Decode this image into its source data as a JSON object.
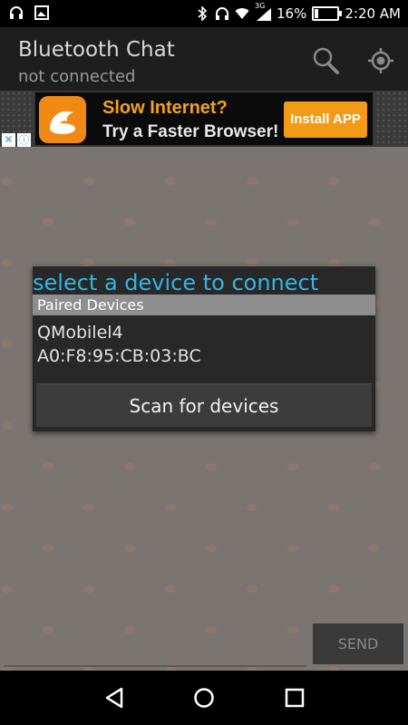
{
  "statusbar": {
    "battery_percent": "16%",
    "time": "2:20 AM",
    "network_type": "3G",
    "icons": [
      "headset-icon",
      "image-icon",
      "bluetooth-icon",
      "headphones-icon",
      "wifi-icon",
      "signal-icon",
      "battery-icon"
    ]
  },
  "actionbar": {
    "title": "Bluetooth Chat",
    "subtitle": "not connected",
    "actions": [
      "search-icon",
      "location-target-icon"
    ]
  },
  "ad": {
    "headline": "Slow Internet?",
    "subline": "Try a Faster Browser!",
    "cta": "Install APP",
    "close_glyph": "✕",
    "info_glyph": "ⓘ"
  },
  "dialog": {
    "title": "select a device to connect",
    "section_header": "Paired Devices",
    "devices": [
      {
        "name": "QMobilel4",
        "address": "A0:F8:95:CB:03:BC"
      }
    ],
    "scan_button": "Scan for devices"
  },
  "composer": {
    "send_label": "SEND"
  },
  "navbar": {
    "buttons": [
      "back-icon",
      "home-icon",
      "recents-icon"
    ]
  },
  "colors": {
    "accent": "#33b5e5",
    "ad_orange": "#f39a16",
    "background": "#7a7570"
  }
}
